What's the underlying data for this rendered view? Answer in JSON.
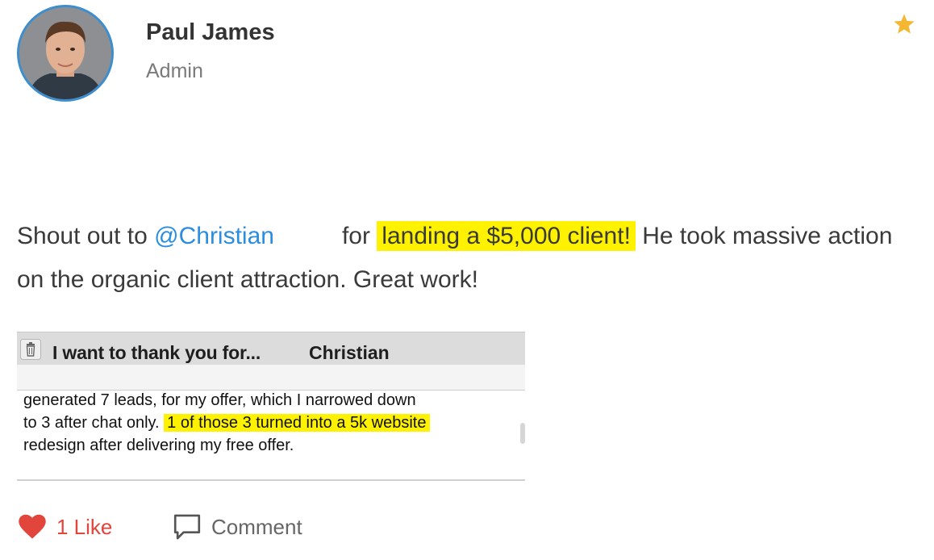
{
  "author": {
    "name": "Paul James",
    "role": "Admin"
  },
  "post": {
    "prefix": "Shout out to ",
    "mention": "@Christian",
    "for_word": "for",
    "highlight": "landing a $5,000 client!",
    "suffix": " He took massive action on the organic client attraction. Great work!"
  },
  "screenshot": {
    "subject": "I want to thank you for...",
    "from": "Christian",
    "line1": "generated 7 leads, for my offer, which I narrowed down",
    "line2_before": "to 3 after chat only. ",
    "line2_highlight": "1 of those 3 turned into a 5k website",
    "line3": "redesign after delivering my free offer."
  },
  "actions": {
    "like_label": "1 Like",
    "comment_label": "Comment"
  },
  "icons": {
    "star": "star-icon",
    "heart": "heart-icon",
    "comment": "comment-icon",
    "trash": "trash-icon"
  },
  "colors": {
    "highlight": "#fff200",
    "mention": "#2b8de0",
    "like": "#e2453c",
    "star": "#f5b731",
    "avatar_ring": "#3c8ecf"
  }
}
